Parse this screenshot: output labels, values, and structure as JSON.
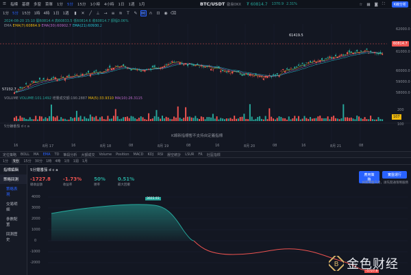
{
  "topbar": {
    "items": [
      "指標",
      "基礎",
      "多窗",
      "菜單",
      "1分",
      "5分",
      "15分",
      "1小時",
      "4小時",
      "1日",
      "1週",
      "1月"
    ],
    "active_item": "5分",
    "pair": "BTC/USDT",
    "exchange": "歐易OKX",
    "last_price": "₮ 60814.7",
    "change_abs": "1370.9",
    "change_pct": "2.31%",
    "kline_button": "K線分析"
  },
  "toolbar": {
    "items": [
      "1分",
      "5分",
      "15分",
      "1時",
      "4時",
      "1日",
      "1週"
    ],
    "active": "5分"
  },
  "legends": {
    "ohlc": "2024-08-20 15:10 開60814.4 高60833.5 低60814.6 收60814.7 振幅0.06%",
    "ema_label": "EMA",
    "ema7": "EMA(7):60864.9",
    "ema30": "EMA(30):60902.7",
    "ema21": "EMA(21):60930.2"
  },
  "price_axis": {
    "ticks": [
      "62000.0",
      "61000.0",
      "60000.0",
      "59000.0",
      "58000.0",
      "57000.0"
    ],
    "current": "60814.7",
    "high_marker": "61419.5",
    "low_marker": "57232.7"
  },
  "volume": {
    "legend_label": "VOLUME",
    "legend_value": "VOLUME:101.1492",
    "legend_extra": "增量成交額:190.2887",
    "ma5": "MA(5):33.9310",
    "ma10": "MA(10):26.3115",
    "axis_ticks": [
      "200",
      "100"
    ],
    "current": "107"
  },
  "time_axis": [
    "16",
    "8月 17",
    "16",
    "8月 18",
    "08",
    "8月 19",
    "08",
    "16",
    "8月 20",
    "08",
    "16",
    "8月 21",
    "08"
  ],
  "indicator": {
    "label": "5分鐘番茄 d c a",
    "notice": "K線新指標暫不支持自定義指標"
  },
  "tabs_row": {
    "items": [
      "定位策略",
      "BOLL",
      "MA",
      "EMA",
      "TD",
      "筆段分析",
      "大額成交",
      "Volume",
      "Position",
      "MACD",
      "KDJ",
      "RSI",
      "壓空統計",
      "LSUR",
      "FR",
      "社區指標"
    ],
    "active": "EMA"
  },
  "tabs_row2": {
    "items": [
      "1分",
      "5分",
      "15分",
      "30分",
      "1時",
      "4時",
      "1日",
      "1週",
      "1月"
    ],
    "active": "5分"
  },
  "sidebar": {
    "header": "指標編輯",
    "group": "策略回測",
    "subs": [
      "策略表現",
      "交易明細",
      "參數配置",
      "回測歷史"
    ],
    "active_sub": "策略表現"
  },
  "strategy": {
    "name": "5分鐘番茄 d c a",
    "stats": [
      {
        "value": "-1727.8",
        "label": "總收益額",
        "color": "#ef5350"
      },
      {
        "value": "-1.73%",
        "label": "收益率",
        "color": "#ef5350"
      },
      {
        "value": "50%",
        "label": "勝率",
        "color": "#26a69a"
      },
      {
        "value": "0.51%",
        "label": "最大回撤",
        "color": "#26a69a"
      }
    ],
    "buttons": {
      "compare": "應用策略",
      "publish": "實盤運行"
    },
    "hint1": "如需實盤交易，請先開通策略服務",
    "hint2": "",
    "equity_axis": [
      "4000",
      "3000",
      "2000",
      "1000",
      "0",
      "-1000",
      "-2000"
    ],
    "peak_label": "3603.93",
    "end_label": "-1727.8"
  },
  "watermark": {
    "text": "金色财经"
  },
  "colors": {
    "up": "#26a69a",
    "down": "#ef5350",
    "accent": "#2962ff",
    "ema_yellow": "#f0b90b",
    "background": "#131722"
  }
}
